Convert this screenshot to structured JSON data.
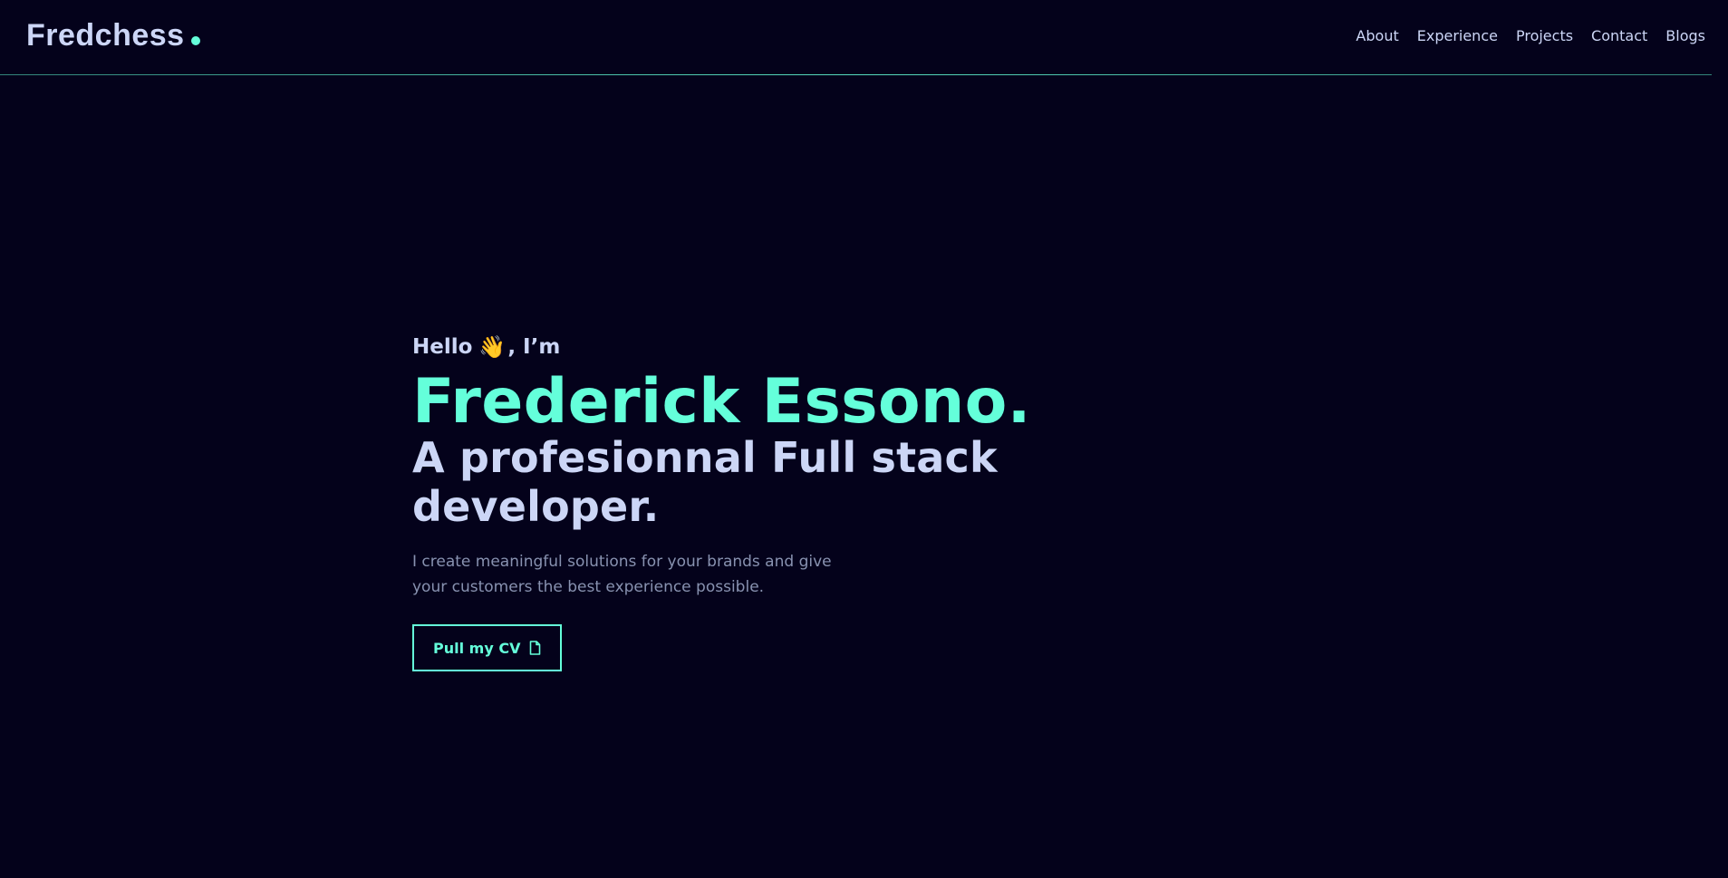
{
  "header": {
    "logo": "Fredchess",
    "nav": [
      "About",
      "Experience",
      "Projects",
      "Contact",
      "Blogs"
    ]
  },
  "hero": {
    "greeting_prefix": "Hello",
    "greeting_emoji": "👋",
    "greeting_suffix": ", I’m",
    "name": "Frederick Essono.",
    "role": "A profesionnal Full stack developer.",
    "description": "I create meaningful solutions for your brands and give your customers the best experience possible.",
    "cta_label": "Pull my CV",
    "cta_icon": "document-icon"
  },
  "colors": {
    "background": "#04021b",
    "accent": "#64ffda",
    "heading": "#ccd6f6",
    "body_text": "#8892b0"
  }
}
